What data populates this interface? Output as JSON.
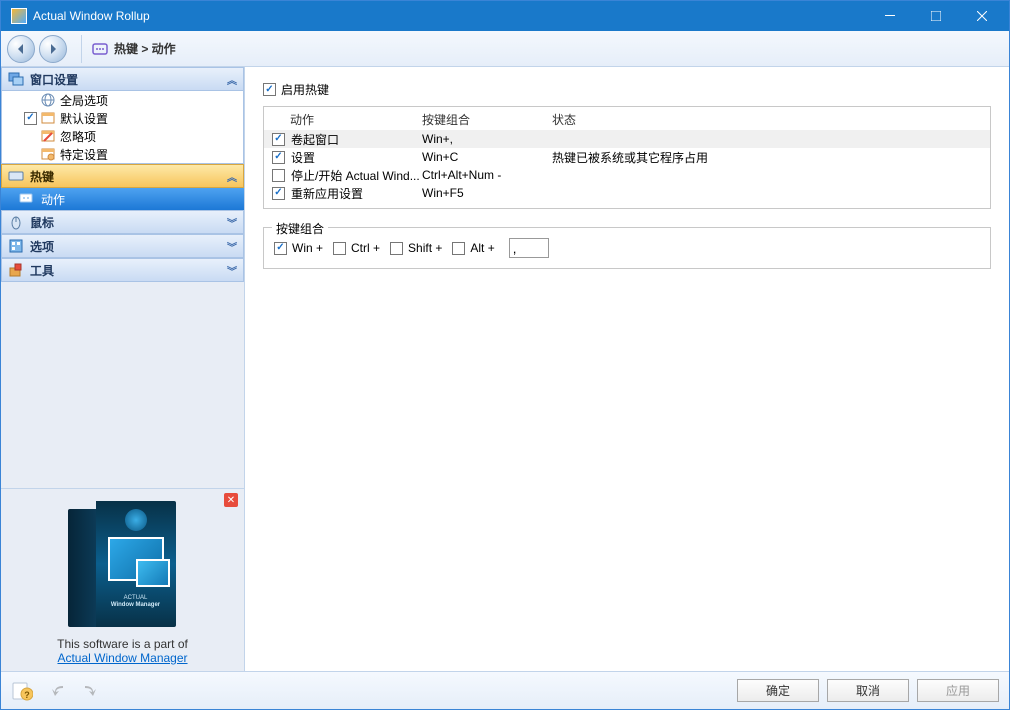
{
  "window": {
    "title": "Actual Window Rollup"
  },
  "breadcrumb": {
    "text": "热键 > 动作"
  },
  "sidebar": {
    "sections": {
      "windowSettings": {
        "label": "窗口设置",
        "items": [
          "全局选项",
          "默认设置",
          "忽略项",
          "特定设置"
        ]
      },
      "hotkeys": {
        "label": "热键",
        "sub": "动作"
      },
      "mouse": {
        "label": "鼠标"
      },
      "options": {
        "label": "选项"
      },
      "tools": {
        "label": "工具"
      }
    }
  },
  "promo": {
    "text": "This software is a part of",
    "link": "Actual Window Manager",
    "boxLine1": "ACTUAL",
    "boxLine2": "Window Manager"
  },
  "content": {
    "enableHotkeys": "启用热键",
    "columns": {
      "action": "动作",
      "combo": "按键组合",
      "status": "状态"
    },
    "rows": [
      {
        "checked": true,
        "action": "卷起窗口",
        "combo": "Win+,",
        "status": ""
      },
      {
        "checked": true,
        "action": "设置",
        "combo": "Win+C",
        "status": "热键已被系统或其它程序占用"
      },
      {
        "checked": false,
        "action": "停止/开始 Actual Wind...",
        "combo": "Ctrl+Alt+Num -",
        "status": ""
      },
      {
        "checked": true,
        "action": "重新应用设置",
        "combo": "Win+F5",
        "status": ""
      }
    ],
    "comboGroup": {
      "legend": "按键组合",
      "win": "Win +",
      "ctrl": "Ctrl +",
      "shift": "Shift +",
      "alt": "Alt +",
      "keyValue": ","
    }
  },
  "footer": {
    "ok": "确定",
    "cancel": "取消",
    "apply": "应用"
  }
}
